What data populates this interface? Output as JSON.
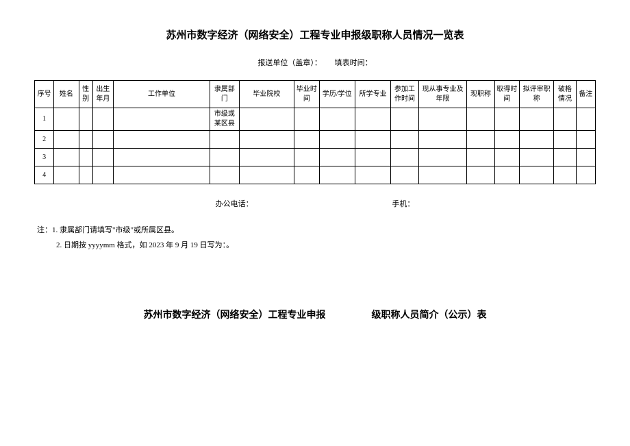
{
  "title": "苏州市数字经济（网络安全）工程专业申报级职称人员情况一览表",
  "meta": {
    "unit_label": "报送单位（盖章）：",
    "date_label": "填表时间："
  },
  "headers": {
    "seq": "序号",
    "name": "姓名",
    "gender": "性别",
    "birth": "出生年月",
    "work_unit": "工作单位",
    "dept": "隶属部门",
    "school": "毕业院校",
    "grad_time": "毕业时间",
    "degree": "学历/学位",
    "major": "所学专业",
    "work_start": "参加工作时间",
    "years": "现从事专业及年限",
    "cur_title": "现职称",
    "obtain_time": "取得时间",
    "apply_title": "拟评审职称",
    "break_rule": "破格情况",
    "remark": "备注"
  },
  "rows": [
    {
      "seq": "1",
      "dept": "市级或某区县"
    },
    {
      "seq": "2",
      "dept": ""
    },
    {
      "seq": "3",
      "dept": ""
    },
    {
      "seq": "4",
      "dept": ""
    }
  ],
  "contact": {
    "office_label": "办公电话：",
    "mobile_label": "手机："
  },
  "notes": {
    "n1": "注：1. 隶属部门请填写\"市级\"或所属区县。",
    "n2": "2. 日期按 yyyymm 格式，如 2023 年 9 月 19 日写为：。"
  },
  "title2_a": "苏州市数字经济（网络安全）工程专业申报",
  "title2_b": "级职称人员简介（公示）表"
}
